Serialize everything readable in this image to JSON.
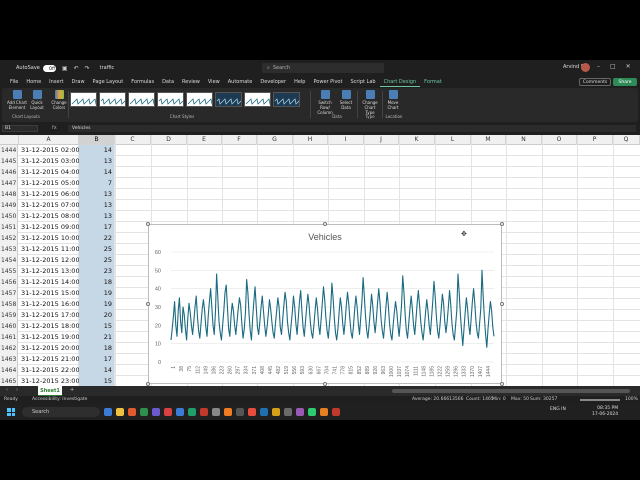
{
  "titlebar": {
    "autosave_label": "AutoSave",
    "autosave_state": "Off",
    "filename": "traffic",
    "search_placeholder": "Search",
    "user_name": "Arvind S"
  },
  "menu": {
    "tabs": [
      "File",
      "Home",
      "Insert",
      "Draw",
      "Page Layout",
      "Formulas",
      "Data",
      "Review",
      "View",
      "Automate",
      "Developer",
      "Help",
      "Power Pivot",
      "Script Lab",
      "Chart Design",
      "Format"
    ],
    "active_tab": "Chart Design",
    "comments_label": "Comments",
    "share_label": "Share"
  },
  "ribbon": {
    "add_chart_element": "Add Chart Element",
    "quick_layout": "Quick Layout",
    "change_colors": "Change Colors",
    "switch_row_column": "Switch Row/ Column",
    "select_data": "Select Data",
    "change_chart_type": "Change Chart Type",
    "move_chart": "Move Chart",
    "groups": {
      "chart_layouts": "Chart Layouts",
      "chart_styles": "Chart Styles",
      "data": "Data",
      "type": "Type",
      "location": "Location"
    }
  },
  "formula_bar": {
    "name_box": "B1",
    "fx_label": "fx",
    "content": "Vehicles"
  },
  "columns": [
    "A",
    "B",
    "C",
    "D",
    "E",
    "F",
    "G",
    "H",
    "I",
    "J",
    "K",
    "L",
    "M",
    "N",
    "O",
    "P",
    "Q"
  ],
  "rows": [
    {
      "num": "1444",
      "a": "31-12-2015 02:00",
      "b": "14"
    },
    {
      "num": "1445",
      "a": "31-12-2015 03:00",
      "b": "13"
    },
    {
      "num": "1446",
      "a": "31-12-2015 04:00",
      "b": "14"
    },
    {
      "num": "1447",
      "a": "31-12-2015 05:00",
      "b": "7"
    },
    {
      "num": "1448",
      "a": "31-12-2015 06:00",
      "b": "13"
    },
    {
      "num": "1449",
      "a": "31-12-2015 07:00",
      "b": "13"
    },
    {
      "num": "1450",
      "a": "31-12-2015 08:00",
      "b": "13"
    },
    {
      "num": "1451",
      "a": "31-12-2015 09:00",
      "b": "17"
    },
    {
      "num": "1452",
      "a": "31-12-2015 10:00",
      "b": "22"
    },
    {
      "num": "1453",
      "a": "31-12-2015 11:00",
      "b": "25"
    },
    {
      "num": "1454",
      "a": "31-12-2015 12:00",
      "b": "25"
    },
    {
      "num": "1455",
      "a": "31-12-2015 13:00",
      "b": "23"
    },
    {
      "num": "1456",
      "a": "31-12-2015 14:00",
      "b": "18"
    },
    {
      "num": "1457",
      "a": "31-12-2015 15:00",
      "b": "19"
    },
    {
      "num": "1458",
      "a": "31-12-2015 16:00",
      "b": "19"
    },
    {
      "num": "1459",
      "a": "31-12-2015 17:00",
      "b": "20"
    },
    {
      "num": "1460",
      "a": "31-12-2015 18:00",
      "b": "15"
    },
    {
      "num": "1461",
      "a": "31-12-2015 19:00",
      "b": "21"
    },
    {
      "num": "1462",
      "a": "31-12-2015 20:00",
      "b": "18"
    },
    {
      "num": "1463",
      "a": "31-12-2015 21:00",
      "b": "17"
    },
    {
      "num": "1464",
      "a": "31-12-2015 22:00",
      "b": "14"
    },
    {
      "num": "1465",
      "a": "31-12-2015 23:00",
      "b": "15"
    }
  ],
  "chart_data": {
    "type": "line",
    "title": "Vehicles",
    "ylim": [
      0,
      60
    ],
    "yticks": [
      0,
      10,
      20,
      30,
      40,
      50,
      60
    ],
    "x_tick_labels": [
      "1",
      "38",
      "75",
      "112",
      "149",
      "186",
      "223",
      "260",
      "297",
      "334",
      "371",
      "408",
      "445",
      "482",
      "519",
      "556",
      "593",
      "630",
      "667",
      "704",
      "741",
      "778",
      "815",
      "852",
      "889",
      "926",
      "963",
      "1000",
      "1037",
      "1074",
      "1111",
      "1148",
      "1185",
      "1222",
      "1259",
      "1296",
      "1333",
      "1370",
      "1407",
      "1444"
    ],
    "series_color": "#1a6a80",
    "series": [
      {
        "name": "Vehicles",
        "values": [
          12,
          18,
          25,
          33,
          20,
          14,
          28,
          35,
          22,
          16,
          30,
          26,
          18,
          12,
          24,
          32,
          27,
          20,
          15,
          22,
          30,
          36,
          25,
          17,
          13,
          21,
          29,
          34,
          28,
          19,
          14,
          25,
          33,
          40,
          30,
          20,
          15,
          27,
          48,
          35,
          22,
          16,
          12,
          20,
          28,
          38,
          42,
          30,
          18,
          14,
          25,
          32,
          28,
          20,
          15,
          22,
          29,
          35,
          31,
          21,
          13,
          18,
          27,
          45,
          38,
          26,
          17,
          12,
          24,
          33,
          41,
          30,
          19,
          15,
          22,
          30,
          36,
          28,
          20,
          14,
          19,
          26,
          34,
          29,
          22,
          16,
          13,
          21,
          28,
          35,
          30,
          19,
          15,
          23,
          31,
          38,
          33,
          22,
          16,
          12,
          20,
          27,
          36,
          30,
          21,
          15,
          24,
          33,
          39,
          28,
          19,
          14,
          22,
          30,
          37,
          31,
          22,
          16,
          13,
          20,
          28,
          35,
          29,
          20,
          15,
          23,
          32,
          41,
          34,
          24,
          17,
          13,
          21,
          29,
          43,
          35,
          24,
          16,
          12,
          18,
          27,
          35,
          30,
          21,
          15,
          22,
          31,
          38,
          32,
          23,
          16,
          13,
          20,
          29,
          36,
          30,
          21,
          15,
          24,
          33,
          46,
          36,
          25,
          17,
          13,
          20,
          28,
          37,
          31,
          22,
          16,
          23,
          32,
          40,
          33,
          23,
          17,
          13,
          21,
          30,
          38,
          31,
          21,
          15,
          12,
          20,
          27,
          33,
          28,
          20,
          14,
          22,
          31,
          47,
          38,
          26,
          17,
          13,
          21,
          29,
          36,
          29,
          20,
          15,
          23,
          32,
          39,
          31,
          22,
          16,
          12,
          19,
          27,
          34,
          28,
          20,
          15,
          24,
          33,
          44,
          36,
          25,
          17,
          13,
          20,
          28,
          37,
          32,
          22,
          16,
          22,
          30,
          39,
          31,
          21,
          15,
          12,
          20,
          28,
          48,
          38,
          26,
          17,
          9,
          18,
          27,
          35,
          29,
          20,
          15,
          24,
          33,
          40,
          32,
          22,
          16,
          13,
          21,
          29,
          50,
          36,
          24,
          15,
          8,
          18,
          26,
          33,
          28,
          19,
          14
        ]
      }
    ]
  },
  "sheet": {
    "tab_name": "Sheet1",
    "accessibility": "Accessibility: Investigate",
    "status_ready": "Ready",
    "average": "Average: 20.66613566",
    "count": "Count: 1465",
    "min": "Min: 0",
    "max": "Max: 50",
    "sum": "Sum: 30257",
    "zoom": "100%"
  },
  "taskbar": {
    "search_placeholder": "Search",
    "lang": "ENG IN",
    "time": "08:35 PM",
    "date": "17-06-2024"
  }
}
